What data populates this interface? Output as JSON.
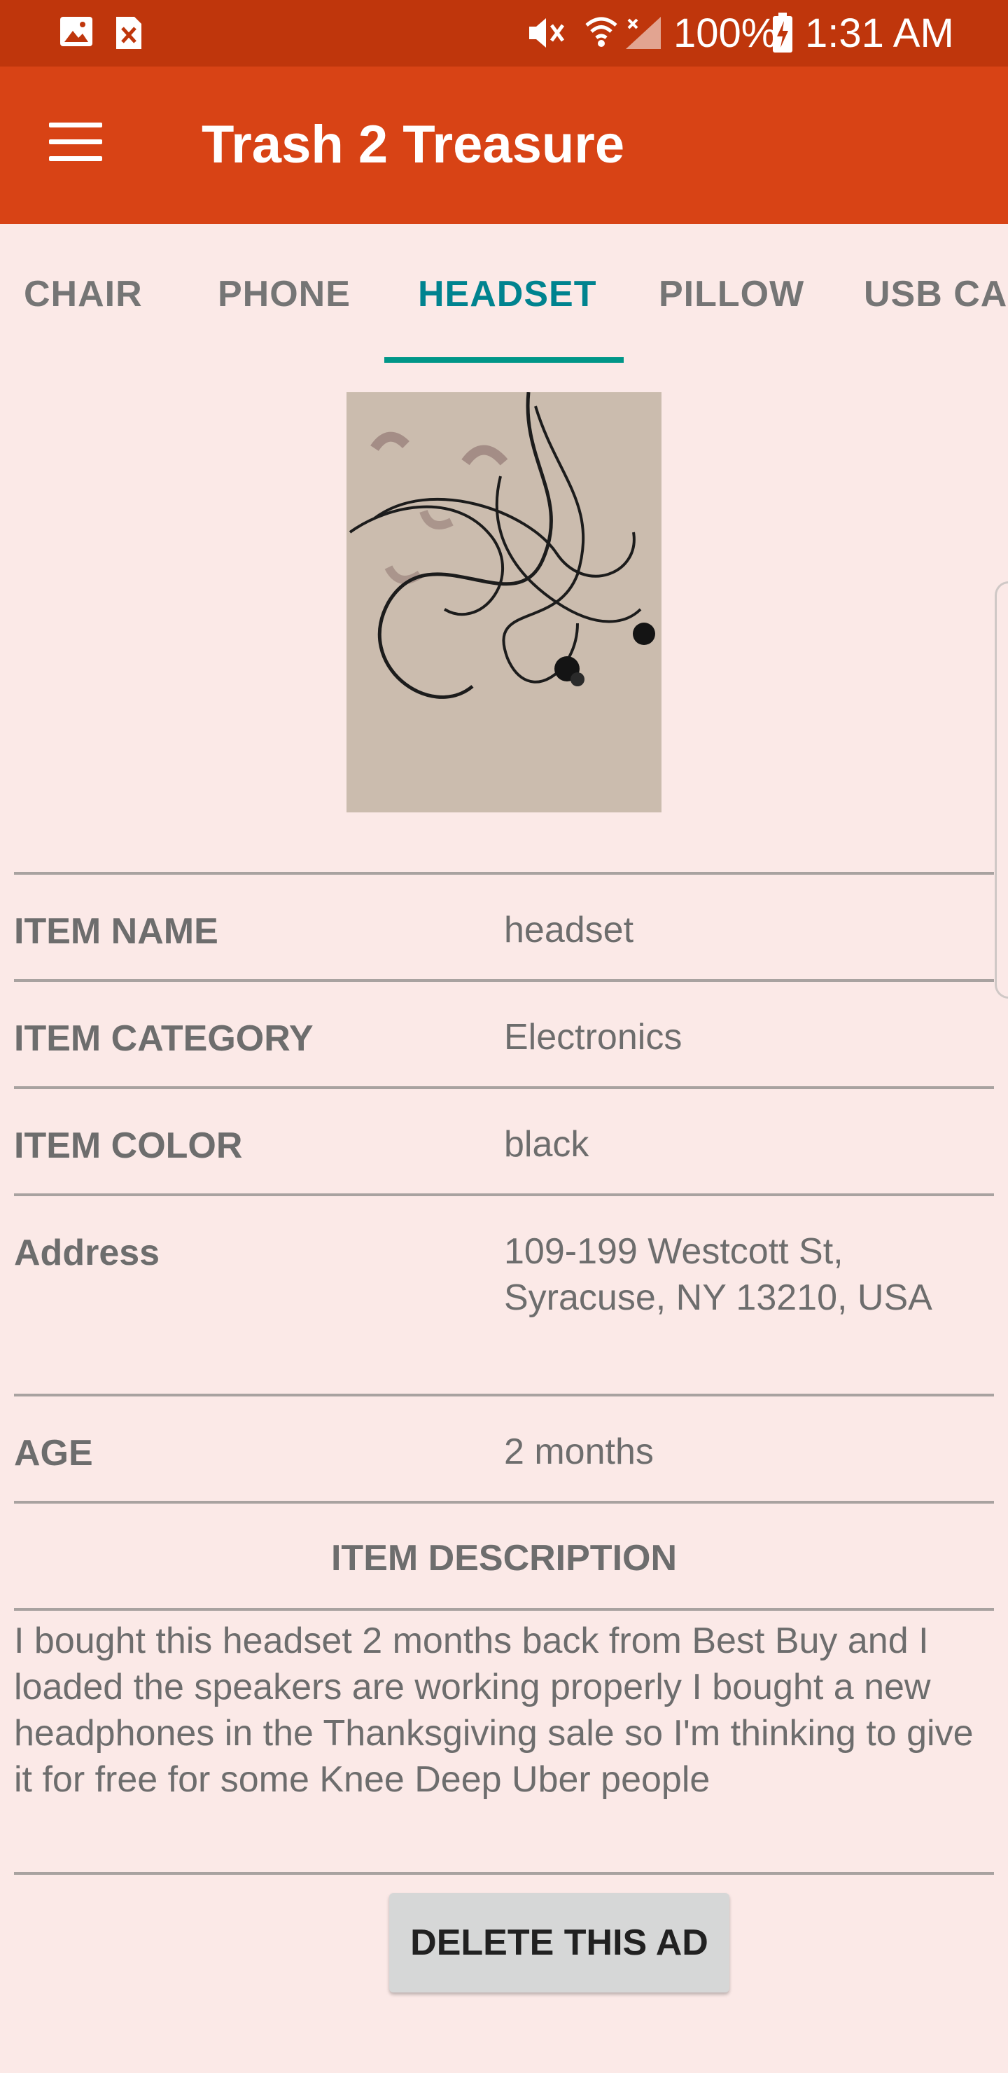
{
  "status_bar": {
    "battery": "100%",
    "time": "1:31 AM",
    "icons": [
      "gallery-icon",
      "close-notification-icon",
      "mute-icon",
      "wifi-icon",
      "signal-icon",
      "battery-charging-icon"
    ]
  },
  "app_bar": {
    "title": "Trash 2 Treasure",
    "menu_icon": "hamburger-menu-icon"
  },
  "tabs": [
    {
      "label": "CHAIR",
      "active": false
    },
    {
      "label": "PHONE",
      "active": false
    },
    {
      "label": "HEADSET",
      "active": true
    },
    {
      "label": "PILLOW",
      "active": false
    },
    {
      "label": "USB CAB",
      "active": false
    }
  ],
  "item": {
    "name_label": "ITEM NAME",
    "name_value": "headset",
    "category_label": "ITEM CATEGORY",
    "category_value": "Electronics",
    "color_label": "ITEM COLOR",
    "color_value": "black",
    "address_label": "Address",
    "address_line1": "109-199 Westcott St,",
    "address_line2": "Syracuse, NY 13210, USA",
    "age_label": "AGE",
    "age_value": "2 months",
    "description_title": "ITEM DESCRIPTION",
    "description": "I bought this headset 2 months back from Best Buy and I loaded the speakers are working properly I bought a new headphones in the Thanksgiving sale so I'm thinking to give it for free for some Knee Deep Uber people"
  },
  "actions": {
    "delete_label": "DELETE THIS AD"
  },
  "colors": {
    "status_bar": "#bf360c",
    "app_bar": "#d84315",
    "background": "#fbe9e7",
    "tab_active": "#00838f",
    "tab_indicator": "#009688"
  }
}
